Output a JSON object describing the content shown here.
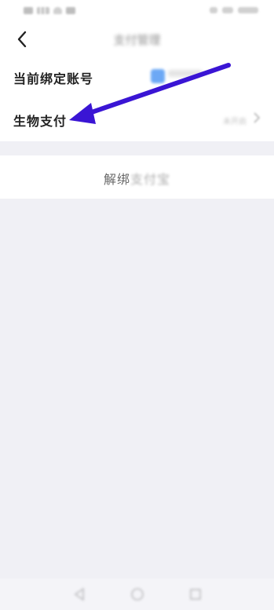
{
  "header": {
    "title": "支付管理",
    "back_icon": "chevron-left-icon"
  },
  "settings": {
    "rows": [
      {
        "label": "当前绑定账号",
        "account_name": "",
        "account_id": "",
        "icon": "account-avatar-icon"
      },
      {
        "label": "生物支付",
        "status": "未开启",
        "icon": "chevron-right-icon"
      }
    ]
  },
  "unbind": {
    "label_part1": "解绑",
    "label_part2": "支付宝"
  },
  "annotation": {
    "color": "#3a15d4",
    "points_to": "生物支付"
  },
  "colors": {
    "page_bg": "#f0f0f5",
    "card_bg": "#ffffff",
    "accent_blue": "#3b8cf2",
    "arrow": "#3a15d4"
  }
}
